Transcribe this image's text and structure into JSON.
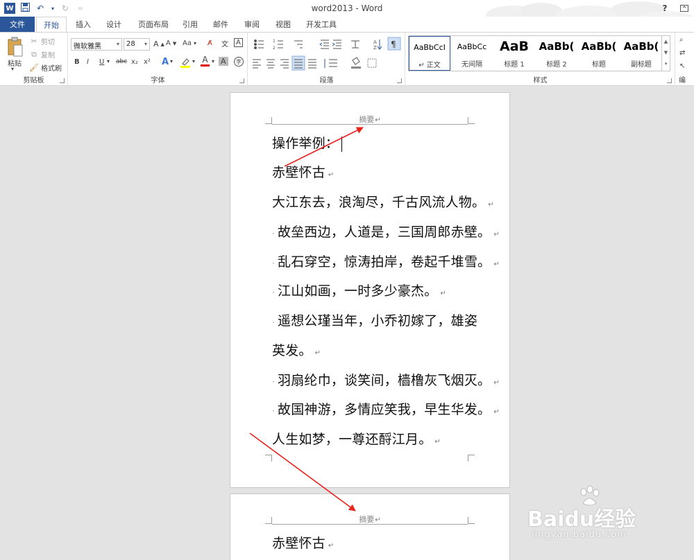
{
  "window": {
    "title": "word2013 - Word",
    "help": "?",
    "qat_customize": "="
  },
  "tabs": [
    "文件",
    "开始",
    "插入",
    "设计",
    "页面布局",
    "引用",
    "邮件",
    "审阅",
    "视图",
    "开发工具"
  ],
  "ribbon": {
    "clipboard": {
      "paste": "粘贴",
      "cut": "剪切",
      "copy": "复制",
      "format_painter": "格式刷",
      "label": "剪贴板"
    },
    "font": {
      "font_name": "微软雅黑",
      "font_size": "28",
      "case_label": "Aa",
      "label": "字体",
      "buttons": [
        "B",
        "I",
        "U",
        "abc",
        "x₂",
        "x²"
      ]
    },
    "paragraph": {
      "label": "段落"
    },
    "styles": {
      "label": "样式",
      "items": [
        {
          "preview": "AaBbCcI",
          "name": "↵ 正文"
        },
        {
          "preview": "AaBbCc",
          "name": "无间隔"
        },
        {
          "preview": "AaB",
          "name": "标题 1"
        },
        {
          "preview": "AaBb(",
          "name": "标题 2"
        },
        {
          "preview": "AaBb(",
          "name": "标题"
        },
        {
          "preview": "AaBb(",
          "name": "副标题"
        }
      ]
    },
    "editing": {
      "label": "编"
    }
  },
  "document": {
    "page1": {
      "header": "摘要",
      "lines": [
        "操作举例：",
        "赤壁怀古",
        "大江东去，浪淘尽，千古风流人物。",
        "故垒西边，人道是，三国周郎赤壁。",
        "乱石穿空，惊涛拍岸，卷起千堆雪。",
        "江山如画，一时多少豪杰。",
        "遥想公瑾当年，小乔初嫁了，雄姿",
        "英发。",
        "羽扇纶巾，谈笑间，樯橹灰飞烟灭。",
        "故国神游，多情应笑我，早生华发。",
        "人生如梦，一尊还酹江月。"
      ]
    },
    "page2": {
      "header": "摘要",
      "lines": [
        "赤壁怀古"
      ]
    }
  },
  "paragraph_mark": "↵",
  "watermark": {
    "brand": "Baidu经验",
    "url": "jingyan.baidu.com"
  },
  "colors": {
    "accent": "#2b579a",
    "arrow": "#e8231c"
  }
}
